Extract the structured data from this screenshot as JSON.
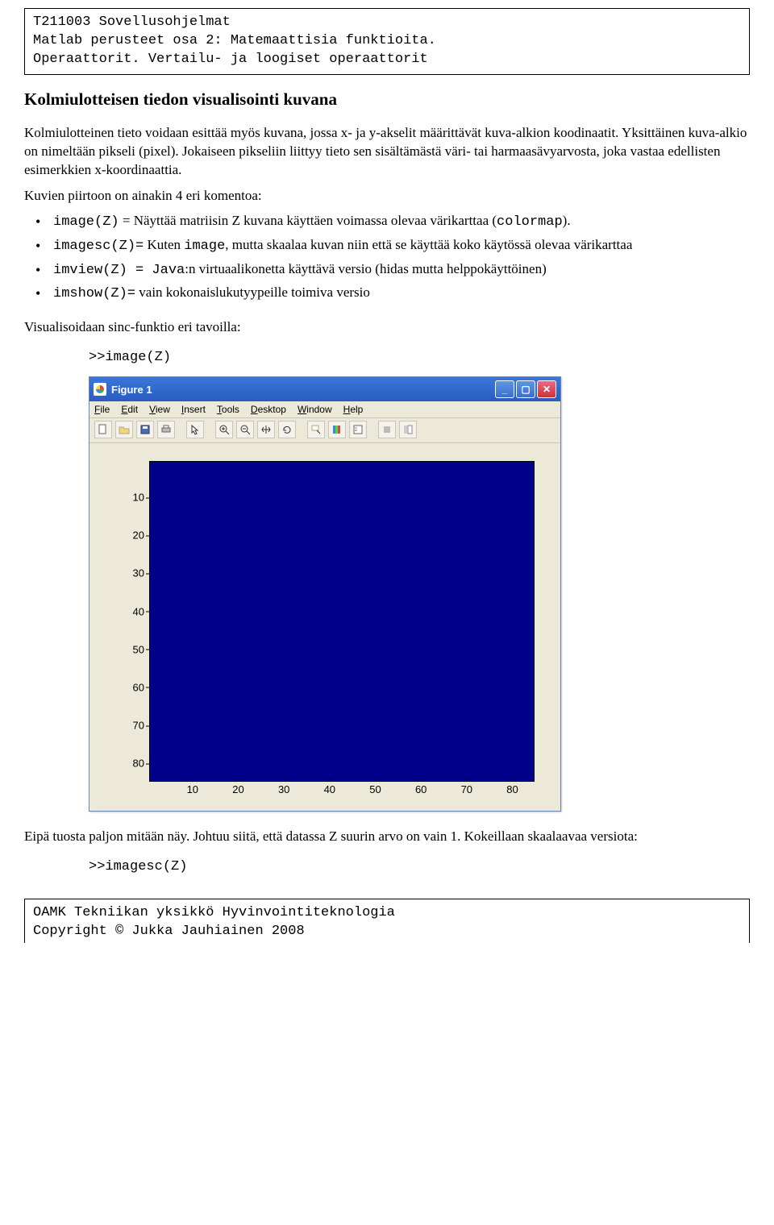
{
  "header": {
    "line1": "T211003 Sovellusohjelmat",
    "line2": "Matlab perusteet osa 2: Matemaattisia funktioita.",
    "line3": "Operaattorit. Vertailu- ja loogiset operaattorit"
  },
  "section_title": "Kolmiulotteisen tiedon visualisointi kuvana",
  "para1": "Kolmiulotteinen tieto voidaan esittää myös kuvana, jossa x- ja y-akselit määrittävät kuva-alkion koodinaatit. Yksittäinen kuva-alkio on nimeltään pikseli (pixel). Jokaiseen pikseliin liittyy tieto sen sisältämästä väri- tai harmaasävyarvosta, joka vastaa edellisten esimerkkien x-koordinaattia.",
  "list_intro": "Kuvien piirtoon on ainakin 4 eri komentoa:",
  "items": [
    {
      "code": "image(Z)",
      "sep": " = ",
      "rest_a": "Näyttää matriisin Z kuvana käyttäen voimassa olevaa värikarttaa (",
      "rest_code": "colormap",
      "rest_b": ")."
    },
    {
      "code": "imagesc(Z)=",
      "sep": "  ",
      "rest_a": "Kuten ",
      "rest_code": "image",
      "rest_b": ", mutta skaalaa kuvan niin että se käyttää koko käytössä olevaa värikarttaa"
    },
    {
      "code": "imview(Z) = Java",
      "sep": ":",
      "rest_a": "n virtuaalikonetta käyttävä versio (hidas mutta helppokäyttöinen)",
      "rest_code": "",
      "rest_b": ""
    },
    {
      "code": "imshow(Z)=",
      "sep": "  ",
      "rest_a": "vain kokonaislukutyypeille toimiva versio",
      "rest_code": "",
      "rest_b": ""
    }
  ],
  "para2": "Visualisoidaan sinc-funktio eri tavoilla:",
  "cmd1": ">>image(Z)",
  "figure": {
    "title": "Figure 1",
    "menus": [
      "File",
      "Edit",
      "View",
      "Insert",
      "Tools",
      "Desktop",
      "Window",
      "Help"
    ],
    "yticks": [
      "10",
      "20",
      "30",
      "40",
      "50",
      "60",
      "70",
      "80"
    ],
    "xticks": [
      "10",
      "20",
      "30",
      "40",
      "50",
      "60",
      "70",
      "80"
    ]
  },
  "chart_data": {
    "type": "heatmap",
    "title": "",
    "xlabel": "",
    "ylabel": "",
    "xlim": [
      0.5,
      84.5
    ],
    "ylim": [
      0.5,
      84.5
    ],
    "xticks": [
      10,
      20,
      30,
      40,
      50,
      60,
      70,
      80
    ],
    "yticks": [
      10,
      20,
      30,
      40,
      50,
      60,
      70,
      80
    ],
    "colormap": "default (jet)",
    "note": "image(Z) rendering of sinc data Z with max value ~1; displays as uniform lowest colormap index (solid dark blue).",
    "data_summary": {
      "rows": 84,
      "cols": 84,
      "displayed_value": 1
    }
  },
  "para3": "Eipä tuosta paljon mitään näy. Johtuu siitä, että datassa Z suurin arvo on vain 1. Kokeillaan skaalaavaa versiota:",
  "cmd2": ">>imagesc(Z)",
  "footer": {
    "line1": "OAMK Tekniikan yksikkö Hyvinvointiteknologia",
    "line2": "Copyright © Jukka Jauhiainen 2008"
  }
}
